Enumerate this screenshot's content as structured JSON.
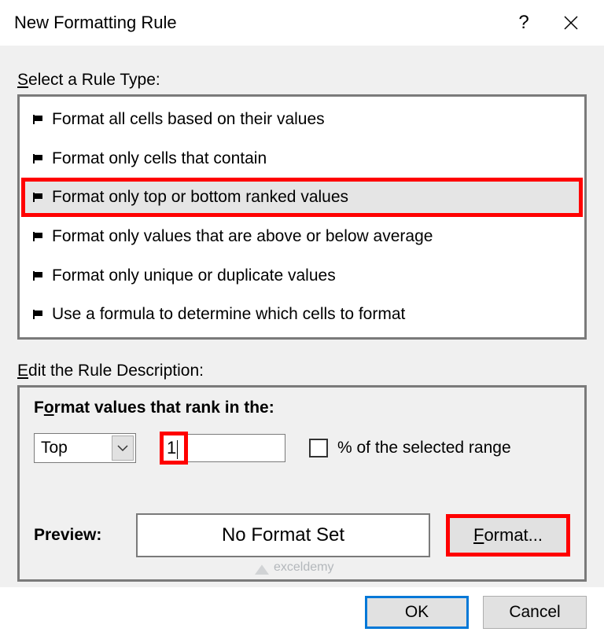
{
  "title": "New Formatting Rule",
  "select_rule_type_label": "Select a Rule Type:",
  "rule_types": [
    {
      "label": "Format all cells based on their values",
      "selected": false
    },
    {
      "label": "Format only cells that contain",
      "selected": false
    },
    {
      "label": "Format only top or bottom ranked values",
      "selected": true
    },
    {
      "label": "Format only values that are above or below average",
      "selected": false
    },
    {
      "label": "Format only unique or duplicate values",
      "selected": false
    },
    {
      "label": "Use a formula to determine which cells to format",
      "selected": false
    }
  ],
  "edit_rule_description_label": "Edit the Rule Description:",
  "rank_section": {
    "heading_prefix": "F",
    "heading_ul": "o",
    "heading_suffix": "rmat values that rank in the:",
    "direction_value": "Top",
    "count_value": "1",
    "percent_label": "% of the selected range",
    "percent_checked": false
  },
  "preview_label": "Preview:",
  "preview_text": "No Format Set",
  "format_button_ul": "F",
  "format_button_suffix": "ormat...",
  "ok_label": "OK",
  "cancel_label": "Cancel",
  "watermark": "exceldemy"
}
